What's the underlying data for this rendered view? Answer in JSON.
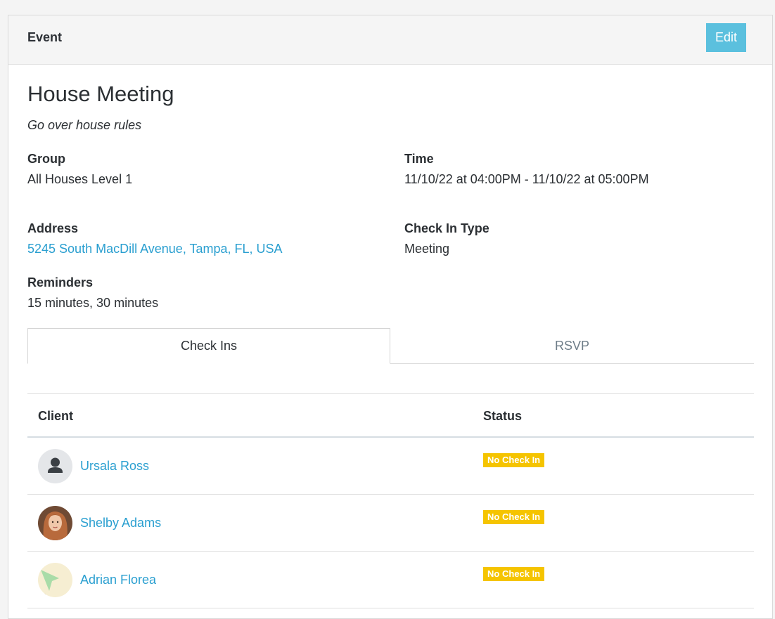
{
  "header": {
    "title": "Event",
    "edit_label": "Edit"
  },
  "event": {
    "title": "House Meeting",
    "description": "Go over house rules",
    "fields": {
      "group_label": "Group",
      "group_value": "All Houses Level 1",
      "time_label": "Time",
      "time_value": "11/10/22 at 04:00PM - 11/10/22 at 05:00PM",
      "address_label": "Address",
      "address_value": "5245 South MacDill Avenue, Tampa, FL, USA",
      "checkin_type_label": "Check In Type",
      "checkin_type_value": "Meeting",
      "reminders_label": "Reminders",
      "reminders_value": "15 minutes, 30 minutes"
    }
  },
  "tabs": [
    {
      "label": "Check Ins",
      "active": true
    },
    {
      "label": "RSVP",
      "active": false
    }
  ],
  "table": {
    "columns": [
      "Client",
      "Status"
    ],
    "rows": [
      {
        "client": "Ursala Ross",
        "status": "No Check In",
        "avatar": "default-person-icon"
      },
      {
        "client": "Shelby Adams",
        "status": "No Check In",
        "avatar": "photo"
      },
      {
        "client": "Adrian Florea",
        "status": "No Check In",
        "avatar": "photo"
      }
    ]
  },
  "colors": {
    "accent": "#5bc0de",
    "link": "#2a9fd0",
    "badge": "#f5c400"
  }
}
